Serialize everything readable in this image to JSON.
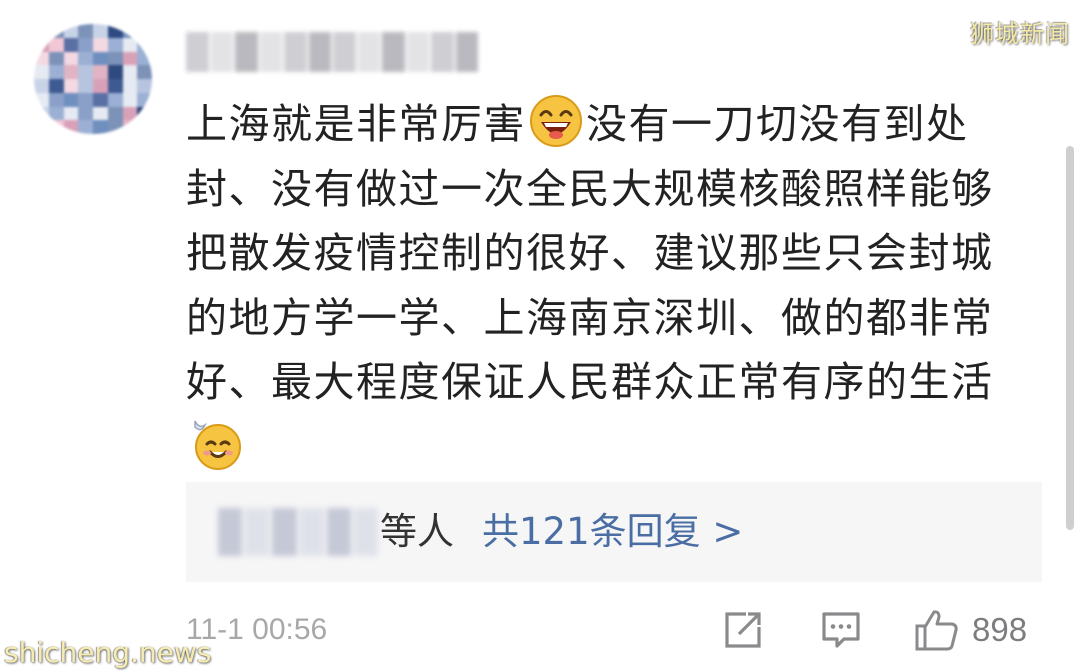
{
  "watermark_top_right": "狮城新闻",
  "watermark_bottom_left": "shicheng.news",
  "comment": {
    "lines": [
      {
        "before": "上海就是非常厉害",
        "after": "没有一刀切没有到处"
      },
      {
        "text": "封、没有做过一次全民大规模核酸照样能够"
      },
      {
        "text": "把散发疫情控制的很好、建议那些只会封城"
      },
      {
        "text": "的地方学一学、上海南京深圳、做的都非常"
      },
      {
        "text": "好、最大程度保证人民群众正常有序的生活"
      }
    ],
    "emoji_inline": "laughing-emoji",
    "emoji_end": "relieved-emoji"
  },
  "replies": {
    "etc_label": "等人",
    "link_label": "共121条回复 >"
  },
  "footer": {
    "timestamp": "11-1 00:56",
    "like_count": "898",
    "share_icon": "share-icon",
    "reply_icon": "comment-icon",
    "like_icon": "thumbs-up-icon"
  },
  "colors": {
    "text": "#222222",
    "link": "#4a6ea3",
    "meta": "#a8a8ab",
    "reply_bg": "#f6f6f7"
  }
}
